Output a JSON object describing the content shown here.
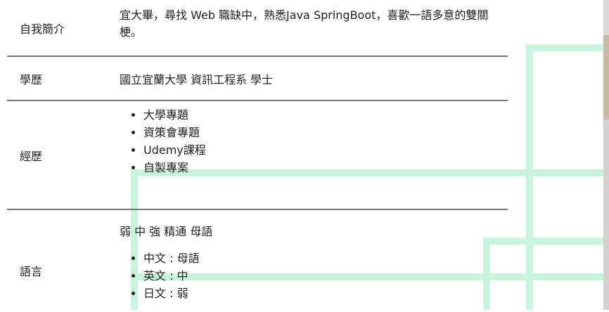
{
  "profile": {
    "intro": {
      "label": "自我簡介",
      "value": "宜大畢，尋找 Web 職缺中，熟悉Java SpringBoot，喜歡一語多意的雙關梗。"
    },
    "education": {
      "label": "學歷",
      "value": "國立宜蘭大學 資訊工程系 學士"
    },
    "experience": {
      "label": "經歷",
      "items": [
        "大學專題",
        "資策會專題",
        "Udemy課程",
        "自製專案"
      ]
    },
    "languages": {
      "label": "語言",
      "levels_legend": "弱 中 強 精通 母語",
      "items": [
        "中文 : 母語",
        "英文 : 中",
        "日文 : 弱"
      ]
    }
  },
  "colors": {
    "decor_line": "#c8f5dc",
    "separator": "#777777",
    "text": "#222222"
  }
}
